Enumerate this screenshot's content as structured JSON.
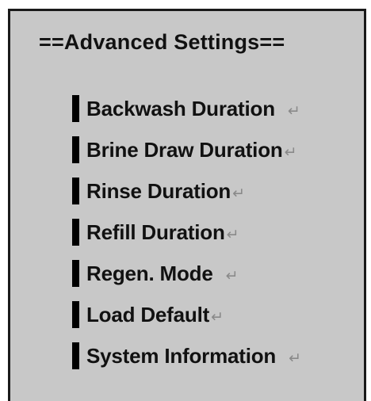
{
  "menu": {
    "title": "==Advanced Settings==",
    "items": [
      {
        "label": "Backwash Duration",
        "icon": "return-icon"
      },
      {
        "label": "Brine Draw Duration",
        "icon": "return-icon"
      },
      {
        "label": "Rinse Duration",
        "icon": "return-icon"
      },
      {
        "label": "Refill Duration",
        "icon": "return-icon"
      },
      {
        "label": "Regen. Mode",
        "icon": "return-icon"
      },
      {
        "label": "Load Default",
        "icon": "return-icon"
      },
      {
        "label": "System Information",
        "icon": "return-icon"
      }
    ]
  },
  "colors": {
    "panel_background": "#c8c8c8",
    "text": "#111111",
    "marker": "#000000",
    "return_icon": "#8a8a8a"
  }
}
